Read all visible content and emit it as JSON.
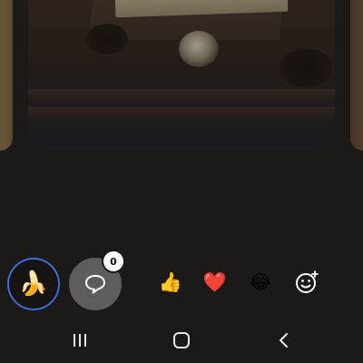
{
  "photo": {
    "description_icon": "photo-content"
  },
  "actions": {
    "banana_icon": "🍌",
    "comment_icon": "speech-bubble-icon",
    "comment_count": "0",
    "reactions": [
      {
        "name": "thumbs-up",
        "glyph": "👍"
      },
      {
        "name": "heart",
        "glyph": "❤️"
      },
      {
        "name": "laughing",
        "glyph": "😂"
      },
      {
        "name": "add-emoji",
        "glyph": "add-reaction-icon"
      }
    ],
    "accent": "#3b6fd6"
  },
  "nav": {
    "recent": "recent-apps-icon",
    "home": "home-icon",
    "back": "back-icon"
  }
}
